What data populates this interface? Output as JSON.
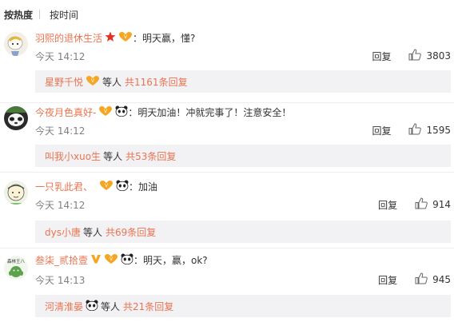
{
  "sort": {
    "hot": "按热度",
    "time": "按时间"
  },
  "comments": [
    {
      "username": "羽熙的退休生活",
      "text": "：明天赢，懂?",
      "time": "今天 14:12",
      "reply_label": "回复",
      "likes": "3803",
      "sub": {
        "name": "星野千悦",
        "etc": "等人",
        "more": "共1161条回复"
      }
    },
    {
      "username": "今夜月色真好-",
      "text": "：明天加油！冲就完事了！注意安全！",
      "time": "今天 14:12",
      "reply_label": "回复",
      "likes": "1595",
      "sub": {
        "name": "叫我小xuo生",
        "etc": "等人",
        "more": "共53条回复"
      }
    },
    {
      "username": "一只乳此君、",
      "text": "：加油",
      "time": "今天 14:12",
      "reply_label": "回复",
      "likes": "914",
      "sub": {
        "name": "dys小唐",
        "etc": "等人",
        "more": "共69条回复"
      }
    },
    {
      "username": "叁柒_贰拾壹",
      "text": "：明天，赢，ok?",
      "time": "今天 14:13",
      "reply_label": "回复",
      "likes": "945",
      "sub": {
        "name": "河清淮晏",
        "etc": "等人",
        "more": "共21条回复"
      }
    }
  ],
  "avatar_text_4": "森林王八",
  "colors": {
    "username": "#eb7350",
    "sub_bg": "#f2f2f5",
    "meta": "#808080"
  }
}
